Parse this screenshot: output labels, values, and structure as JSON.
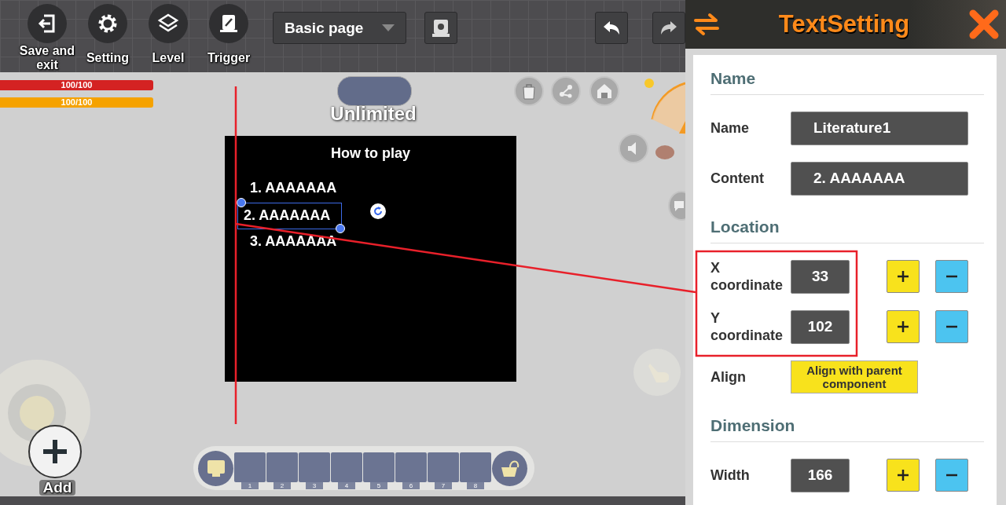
{
  "toolbar": {
    "buttons": [
      {
        "kind": "exit",
        "label": "Save and exit"
      },
      {
        "kind": "gear",
        "label": "Setting"
      },
      {
        "kind": "layers",
        "label": "Level"
      },
      {
        "kind": "scroll",
        "label": "Trigger"
      }
    ],
    "page_select": {
      "value": "Basic page"
    }
  },
  "hud": {
    "bars": [
      {
        "reading": "100/100",
        "level": 1,
        "color": "#d42222"
      },
      {
        "reading": "100/100",
        "level": 1,
        "color": "#f5a200"
      }
    ],
    "mode_label": "Unlimited",
    "add_label": "Add",
    "hotbar_slots": [
      "1",
      "2",
      "3",
      "4",
      "5",
      "6",
      "7",
      "8"
    ]
  },
  "canvas": {
    "title": "How to play",
    "items": [
      {
        "text": "1. AAAAAAA",
        "selected": false
      },
      {
        "text": "2. AAAAAAA",
        "selected": true
      },
      {
        "text": "3. AAAAAAA",
        "selected": false
      }
    ]
  },
  "panel": {
    "title": "TextSetting",
    "sections": [
      {
        "heading": "Name",
        "rows": [
          {
            "kind": "text",
            "label": "Name",
            "value": "Literature1"
          },
          {
            "kind": "text",
            "label": "Content",
            "value": "2. AAAAAAA"
          }
        ]
      },
      {
        "heading": "Location",
        "rows": [
          {
            "kind": "stepper",
            "label": "X coordinate",
            "value": "33"
          },
          {
            "kind": "stepper",
            "label": "Y coordinate",
            "value": "102"
          },
          {
            "kind": "button",
            "label": "Align",
            "value": "Align with parent component"
          }
        ]
      },
      {
        "heading": "Dimension",
        "rows": [
          {
            "kind": "stepper",
            "label": "Width",
            "value": "166"
          }
        ]
      }
    ]
  }
}
